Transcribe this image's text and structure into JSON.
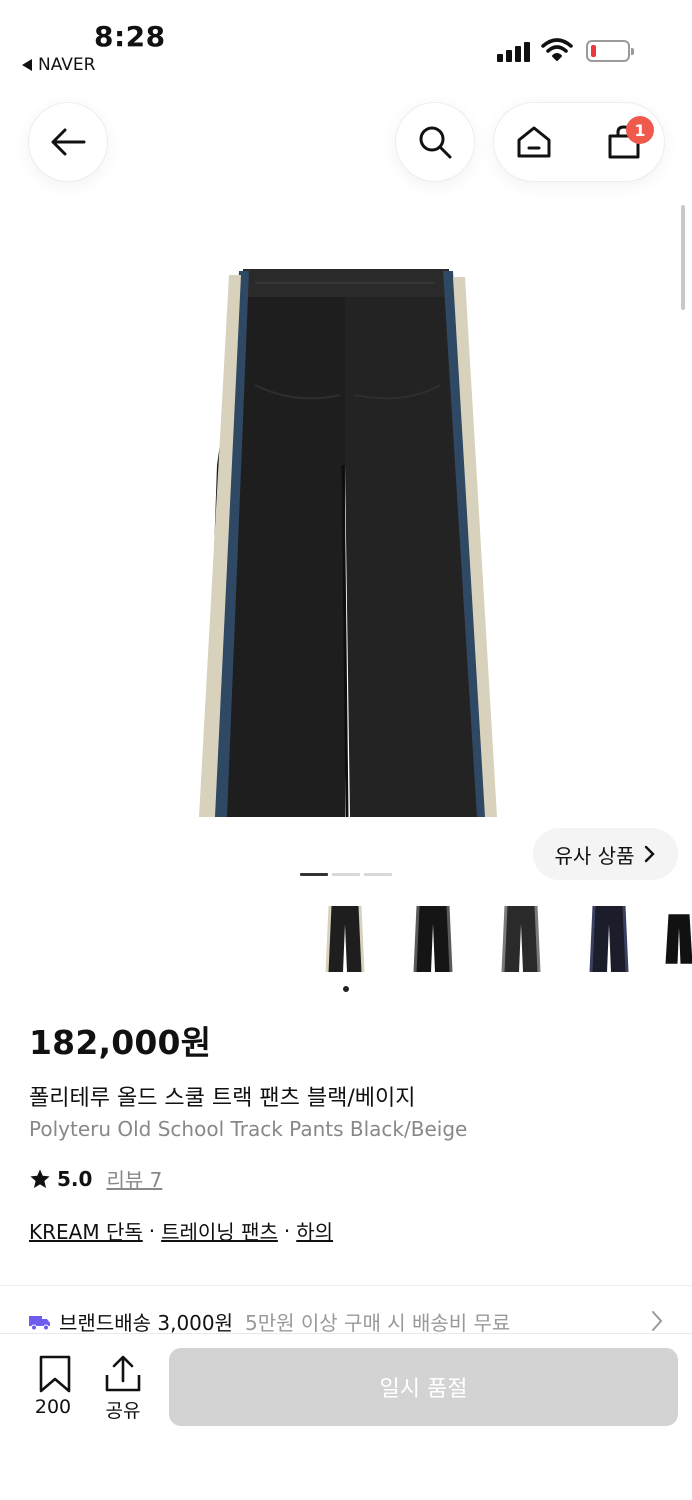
{
  "status_bar": {
    "time": "8:28",
    "back_app": "NAVER",
    "signal_bars": 4,
    "battery_level": 0.1
  },
  "header": {
    "back_icon": "arrow-left-icon",
    "search_icon": "search-icon",
    "home_icon": "home-icon",
    "cart_icon": "shopping-bag-icon",
    "cart_badge": "1"
  },
  "gallery": {
    "similar_products_label": "유사 상품",
    "page_count": 3,
    "active_page": 1
  },
  "thumbnails": {
    "count": 5,
    "active_index": 0
  },
  "product": {
    "price": "182,000원",
    "name_ko": "폴리테루 올드 스쿨 트랙 팬츠 블랙/베이지",
    "name_en": "Polyteru Old School Track Pants Black/Beige",
    "rating": "5.0",
    "review_label": "리뷰 7",
    "categories": [
      "KREAM 단독",
      "트레이닝 팬츠",
      "하의"
    ]
  },
  "shipping": {
    "label": "브랜드배송 3,000원",
    "note": "5만원 이상 구매 시 배송비 무료"
  },
  "bottom_bar": {
    "bookmark_count": "200",
    "share_label": "공유",
    "buy_button": "일시 품절"
  },
  "colors": {
    "badge": "#ef5a4c",
    "soldout_bg": "#d3d3d3",
    "truck": "#6e5cf0"
  }
}
